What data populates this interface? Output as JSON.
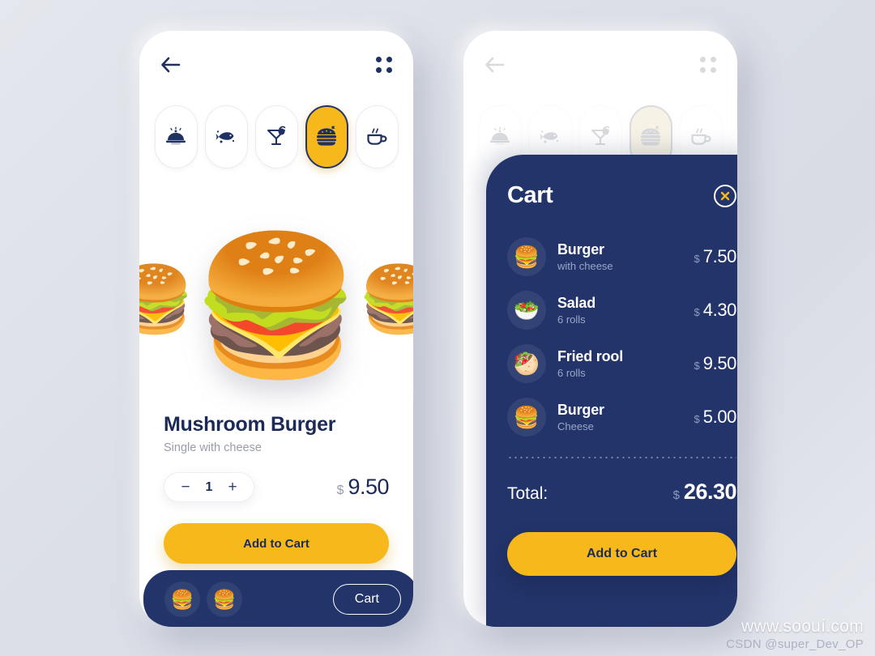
{
  "theme": {
    "navy": "#22346a",
    "yellow": "#f7b81c",
    "background": "#dfe2e9",
    "muted_text": "#9a9da9"
  },
  "screens": {
    "detail": {
      "nav": {
        "back_icon": "arrow-left-icon",
        "menu_icon": "grid-menu-icon"
      },
      "categories": [
        {
          "id": "dish",
          "icon": "cloche-icon",
          "active": false
        },
        {
          "id": "seafood",
          "icon": "fish-icon",
          "active": false
        },
        {
          "id": "drinks",
          "icon": "cocktail-icon",
          "active": false
        },
        {
          "id": "burgers",
          "icon": "burger-icon",
          "active": true
        },
        {
          "id": "coffee",
          "icon": "coffee-cup-icon",
          "active": false
        }
      ],
      "hero": {
        "main_image": "exploded-burger",
        "left_image": "burger-thumb",
        "right_image": "burger-thumb"
      },
      "product": {
        "title": "Mushroom Burger",
        "subtitle": "Single with cheese",
        "quantity": "1",
        "decrement_label": "−",
        "increment_label": "+",
        "currency": "$",
        "price": "9.50"
      },
      "add_to_cart_label": "Add to Cart",
      "bottom_bar": {
        "thumbs": [
          "burger-thumb-1",
          "burger-thumb-2"
        ],
        "cart_label": "Cart"
      }
    },
    "cart": {
      "nav": {
        "back_icon": "arrow-left-icon",
        "menu_icon": "grid-menu-icon"
      },
      "categories": [
        {
          "id": "dish",
          "icon": "cloche-icon",
          "active": false
        },
        {
          "id": "seafood",
          "icon": "fish-icon",
          "active": false
        },
        {
          "id": "drinks",
          "icon": "cocktail-icon",
          "active": false
        },
        {
          "id": "burgers",
          "icon": "burger-icon",
          "active": true
        },
        {
          "id": "coffee",
          "icon": "coffee-cup-icon",
          "active": false
        }
      ],
      "panel": {
        "title": "Cart",
        "close_icon": "close-x-icon",
        "items": [
          {
            "avatar": "burger-thumb",
            "name": "Burger",
            "desc": "with cheese",
            "currency": "$",
            "price": "7.50"
          },
          {
            "avatar": "salad-thumb",
            "name": "Salad",
            "desc": "6 rolls",
            "currency": "$",
            "price": "4.30"
          },
          {
            "avatar": "roll-thumb",
            "name": "Fried rool",
            "desc": "6 rolls",
            "currency": "$",
            "price": "9.50"
          },
          {
            "avatar": "burger-thumb",
            "name": "Burger",
            "desc": "Cheese",
            "currency": "$",
            "price": "5.00"
          }
        ],
        "total_label": "Total:",
        "total_currency": "$",
        "total_price": "26.30",
        "add_to_cart_label": "Add to Cart"
      }
    }
  },
  "watermark": {
    "line1": "www.soouí.com",
    "line2": "CSDN @super_Dev_OP"
  }
}
